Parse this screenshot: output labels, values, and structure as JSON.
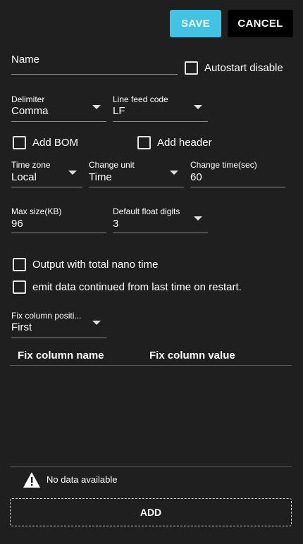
{
  "toolbar": {
    "save_label": "SAVE",
    "cancel_label": "CANCEL"
  },
  "name": {
    "label": "Name",
    "value": ""
  },
  "autostart": {
    "label": "Autostart disable",
    "checked": false
  },
  "delimiter": {
    "label": "Delimiter",
    "value": "Comma"
  },
  "line_feed": {
    "label": "Line feed code",
    "value": "LF"
  },
  "add_bom": {
    "label": "Add BOM",
    "checked": false
  },
  "add_header": {
    "label": "Add header",
    "checked": false
  },
  "time_zone": {
    "label": "Time zone",
    "value": "Local"
  },
  "change_unit": {
    "label": "Change unit",
    "value": "Time"
  },
  "change_time": {
    "label": "Change time(sec)",
    "value": "60"
  },
  "max_size": {
    "label": "Max size(KB)",
    "value": "96"
  },
  "float_digits": {
    "label": "Default float digits",
    "value": "3"
  },
  "nano_time": {
    "label": "Output with total nano time",
    "checked": false
  },
  "emit_continued": {
    "label": "emit data continued from last time on restart.",
    "checked": false
  },
  "fix_column_position": {
    "label": "Fix column positi...",
    "value": "First"
  },
  "table": {
    "columns": [
      "Fix column name",
      "Fix column value"
    ],
    "empty_text": "No data available"
  },
  "add_label": "ADD",
  "colors": {
    "accent": "#40c4e6",
    "background": "#1f1f1f"
  },
  "icons": {
    "warning": "warning-icon",
    "dropdown": "chevron-down-icon"
  }
}
